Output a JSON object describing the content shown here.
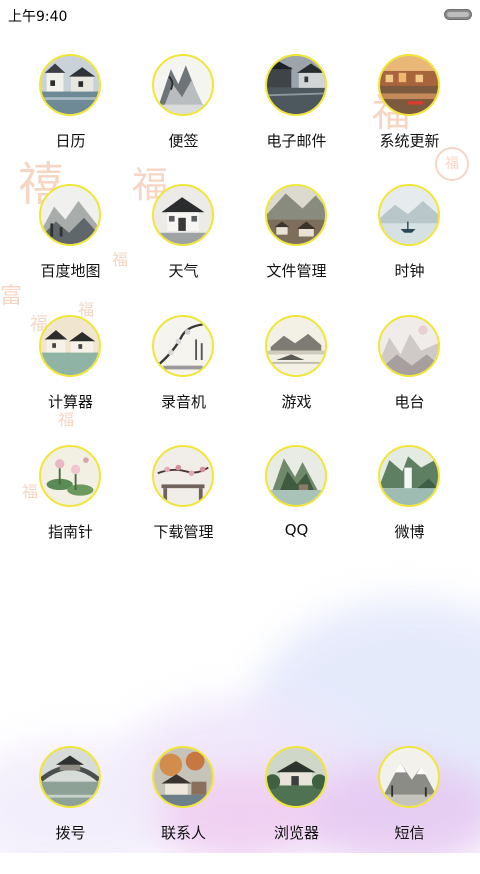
{
  "status_bar": {
    "time": "上午9:40"
  },
  "wallpaper": {
    "glyphs": [
      "禧",
      "富",
      "福",
      "福",
      "福",
      "福",
      "福",
      "福",
      "福",
      "福"
    ]
  },
  "apps": [
    {
      "label": "日历",
      "icon": "water-town-painting-icon"
    },
    {
      "label": "便签",
      "icon": "ink-mountain-painting-icon"
    },
    {
      "label": "电子邮件",
      "icon": "canal-town-painting-icon"
    },
    {
      "label": "系统更新",
      "icon": "sunset-river-painting-icon"
    },
    {
      "label": "百度地图",
      "icon": "misty-hills-painting-icon"
    },
    {
      "label": "天气",
      "icon": "ink-house-painting-icon"
    },
    {
      "label": "文件管理",
      "icon": "mountain-village-painting-icon"
    },
    {
      "label": "时钟",
      "icon": "misty-lake-boat-painting-icon"
    },
    {
      "label": "计算器",
      "icon": "riverside-town-painting-icon"
    },
    {
      "label": "录音机",
      "icon": "plum-blossom-calligraphy-icon"
    },
    {
      "label": "游戏",
      "icon": "ink-landscape-painting-icon"
    },
    {
      "label": "电台",
      "icon": "pale-valley-painting-icon"
    },
    {
      "label": "指南针",
      "icon": "lotus-pond-painting-icon"
    },
    {
      "label": "下载管理",
      "icon": "blossom-branch-painting-icon"
    },
    {
      "label": "QQ",
      "icon": "green-mountain-painting-icon"
    },
    {
      "label": "微博",
      "icon": "waterfall-painting-icon"
    }
  ],
  "dock": [
    {
      "label": "拨号",
      "icon": "stone-bridge-painting-icon"
    },
    {
      "label": "联系人",
      "icon": "autumn-village-painting-icon"
    },
    {
      "label": "浏览器",
      "icon": "garden-pavilion-painting-icon"
    },
    {
      "label": "短信",
      "icon": "snowy-mountain-painting-icon"
    }
  ]
}
